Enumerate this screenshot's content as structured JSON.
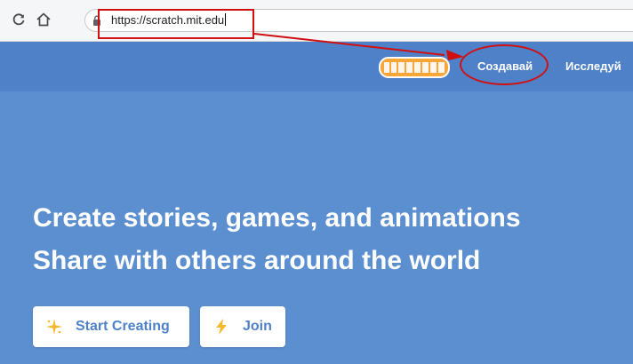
{
  "browser": {
    "url": "https://scratch.mit.edu",
    "back_icon": "reload-icon",
    "home_icon": "home-icon",
    "lock_icon": "lock-icon"
  },
  "scratch": {
    "logo_text": "SCRATCH",
    "nav": {
      "create_label": "Создавай",
      "explore_label": "Исследуй"
    },
    "hero": {
      "line1": "Create stories, games, and animations",
      "line2": "Share with others around the world"
    },
    "buttons": {
      "start_label": "Start Creating",
      "join_label": "Join",
      "start_icon": "sparkle-icon",
      "join_icon": "lightning-icon"
    }
  },
  "colors": {
    "page_blue": "#5b8fd0",
    "nav_blue": "#4f81c9",
    "annotation_red": "#d01010",
    "logo_orange": "#f7a63a"
  }
}
